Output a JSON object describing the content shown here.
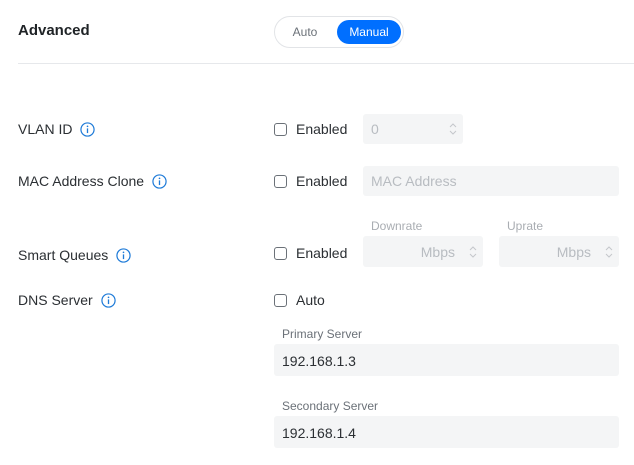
{
  "header": {
    "title": "Advanced"
  },
  "mode": {
    "auto": "Auto",
    "manual": "Manual",
    "selected": "Manual"
  },
  "vlan": {
    "label": "VLAN ID",
    "enabled_label": "Enabled",
    "checked": false,
    "placeholder": "0"
  },
  "mac": {
    "label": "MAC Address Clone",
    "enabled_label": "Enabled",
    "checked": false,
    "placeholder": "MAC Address"
  },
  "queues": {
    "label": "Smart Queues",
    "enabled_label": "Enabled",
    "checked": false,
    "downrate_label": "Downrate",
    "downrate_unit": "Mbps",
    "uprate_label": "Uprate",
    "uprate_unit": "Mbps"
  },
  "dns": {
    "label": "DNS Server",
    "auto_label": "Auto",
    "checked": false,
    "primary_label": "Primary Server",
    "primary_value": "192.168.1.3",
    "secondary_label": "Secondary Server",
    "secondary_value": "192.168.1.4"
  },
  "colors": {
    "accent": "#006fff",
    "info": "#1f7bd8"
  },
  "icons": {
    "info": "info-circle-icon",
    "spinner": "spinner-arrows-icon"
  }
}
